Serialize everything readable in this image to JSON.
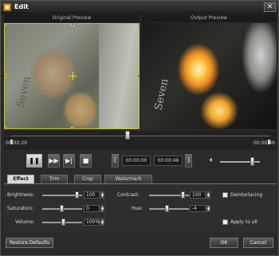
{
  "window": {
    "title": "Edit",
    "close_label": "✕"
  },
  "previews": {
    "original_label": "Original Preview",
    "output_label": "Output Preview",
    "orig_text": "Seven",
    "out_text": "Seven"
  },
  "timeline": {
    "start": "00:00:20",
    "end": "00:00:46"
  },
  "transport": {
    "play": "❚❚",
    "fast_forward": "▶▶",
    "next_frame": "▶|",
    "stop": "■",
    "start_time": "00:00:00",
    "end_time": "00:00:46",
    "bracket_left": "[",
    "bracket_right": "]",
    "volume_level": 0.75
  },
  "tabs": [
    {
      "label": "Effect",
      "active": true
    },
    {
      "label": "Trim",
      "active": false
    },
    {
      "label": "Crop",
      "active": false
    },
    {
      "label": "Watermark",
      "active": false
    }
  ],
  "effect": {
    "brightness": {
      "label": "Brightness:",
      "value": "100"
    },
    "contrast": {
      "label": "Contrast:",
      "value": "100"
    },
    "saturation": {
      "label": "Saturation:",
      "value": "0"
    },
    "hue": {
      "label": "Hue:",
      "value": "-4"
    },
    "volume": {
      "label": "Volume:",
      "value": "100%"
    },
    "deinterlacing": {
      "label": "Deinterlacing",
      "checked": false
    },
    "apply_to_all": {
      "label": "Apply to all",
      "checked": false
    }
  },
  "buttons": {
    "restore_defaults": "Restore Defaults",
    "ok": "OK",
    "cancel": "Cancel"
  },
  "colors": {
    "crop_frame": "#e6df2b",
    "window_bg": "#2a2a2a"
  }
}
